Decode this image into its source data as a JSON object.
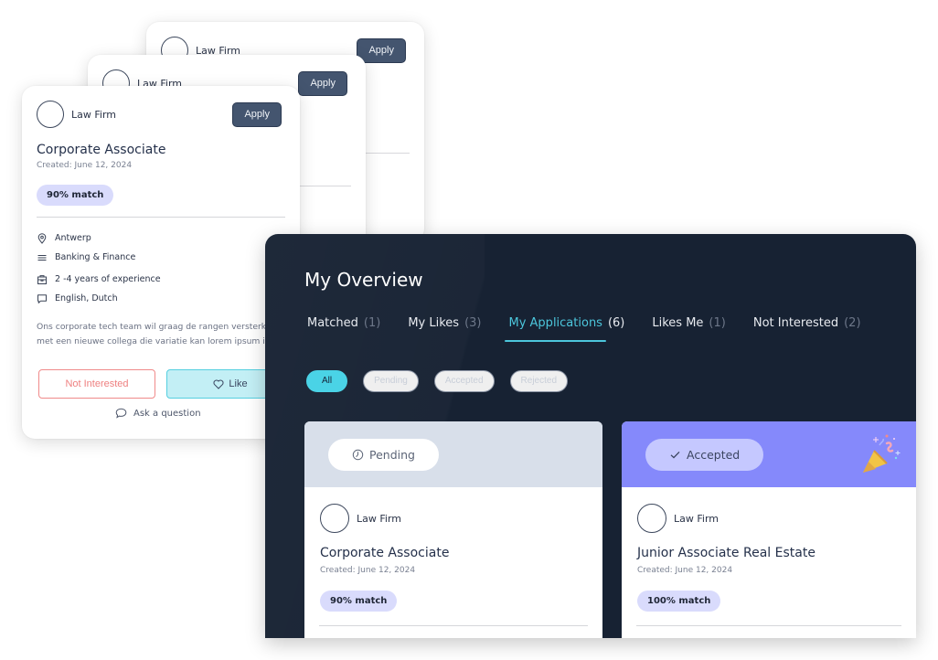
{
  "back_cards": [
    {
      "firm": "Law Firm",
      "apply_label": "Apply"
    },
    {
      "firm": "Law Firm",
      "apply_label": "Apply"
    }
  ],
  "front_card": {
    "firm": "Law Firm",
    "apply_label": "Apply",
    "title": "Corporate Associate",
    "created": "Created: June 12, 2024",
    "match": "90% match",
    "details": [
      {
        "icon": "location-pin-icon",
        "text": "Antwerp"
      },
      {
        "icon": "menu-lines-icon",
        "text": "Banking & Finance"
      },
      {
        "icon": "briefcase-icon",
        "text": "2 -4 years of experience"
      },
      {
        "icon": "chat-bubble-icon",
        "text": "English, Dutch"
      }
    ],
    "description_lines": [
      "Ons corporate tech team wil graag de rangen versterken",
      "met een nieuwe collega die variatie kan lorem ipsum i"
    ],
    "not_interested_label": "Not Interested",
    "like_label": "Like",
    "ask_label": "Ask a question"
  },
  "overview": {
    "title": "My Overview",
    "tabs": [
      {
        "label": "Matched",
        "count": "(1)",
        "active": false
      },
      {
        "label": "My Likes",
        "count": "(3)",
        "active": false
      },
      {
        "label": "My Applications",
        "count": "(6)",
        "active": true
      },
      {
        "label": "Likes Me",
        "count": "(1)",
        "active": false
      },
      {
        "label": "Not Interested",
        "count": "(2)",
        "active": false
      }
    ],
    "filters": [
      {
        "label": "All",
        "active": true
      },
      {
        "label": "Pending",
        "active": false
      },
      {
        "label": "Accepted",
        "active": false
      },
      {
        "label": "Rejected",
        "active": false
      }
    ],
    "applications": [
      {
        "status": "Pending",
        "status_icon": "clock-icon",
        "status_color": "#d8dfea",
        "firm": "Law Firm",
        "title": "Corporate Associate",
        "created": "Created: June 12, 2024",
        "match": "90% match"
      },
      {
        "status": "Accepted",
        "status_icon": "check-icon",
        "status_color": "#8589fb",
        "firm": "Law Firm",
        "title": "Junior Associate Real Estate",
        "created": "Created: June 12, 2024",
        "match": "100% match"
      }
    ]
  },
  "colors": {
    "accent": "#4cc6dc",
    "panel_bg": "#172233",
    "apply_button": "#44556f",
    "match_pill": "#d9dbfc",
    "not_interested": "#ee7f7f",
    "like_bg": "#c3eff5"
  }
}
